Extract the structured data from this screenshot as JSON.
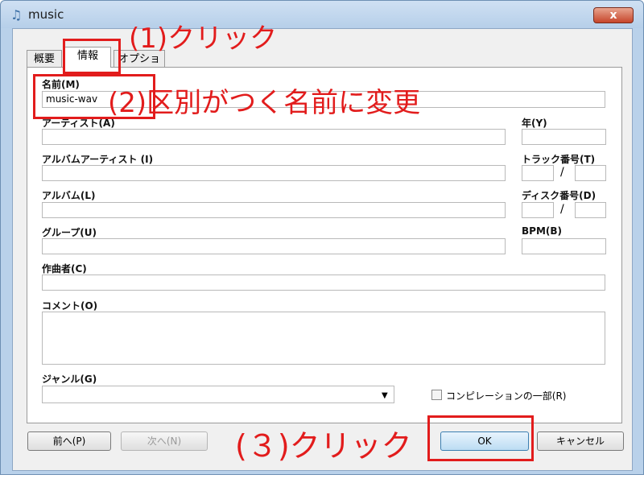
{
  "window": {
    "title": "music",
    "close_glyph": "x"
  },
  "tabs": [
    {
      "label": "概要"
    },
    {
      "label": "情報"
    },
    {
      "label": "オプション"
    }
  ],
  "fields": {
    "name_label": "名前(M)",
    "name_value": "music-wav",
    "artist_label": "アーティスト(A)",
    "year_label": "年(Y)",
    "album_artist_label": "アルバムアーティスト (I)",
    "track_label": "トラック番号(T)",
    "album_label": "アルバム(L)",
    "disc_label": "ディスク番号(D)",
    "group_label": "グループ(U)",
    "bpm_label": "BPM(B)",
    "composer_label": "作曲者(C)",
    "comment_label": "コメント(O)",
    "genre_label": "ジャンル(G)",
    "compilation_label": "コンピレーションの一部(R)",
    "slash": "/"
  },
  "buttons": {
    "prev": "前へ(P)",
    "next": "次へ(N)",
    "ok": "OK",
    "cancel": "キャンセル"
  },
  "annotations": {
    "step1": "(1)クリック",
    "step2": "(2)区別がつく名前に変更",
    "step3": "(３)クリック"
  },
  "colors": {
    "annotation": "#e21c1c",
    "titlebar": "#b9d1ea"
  }
}
